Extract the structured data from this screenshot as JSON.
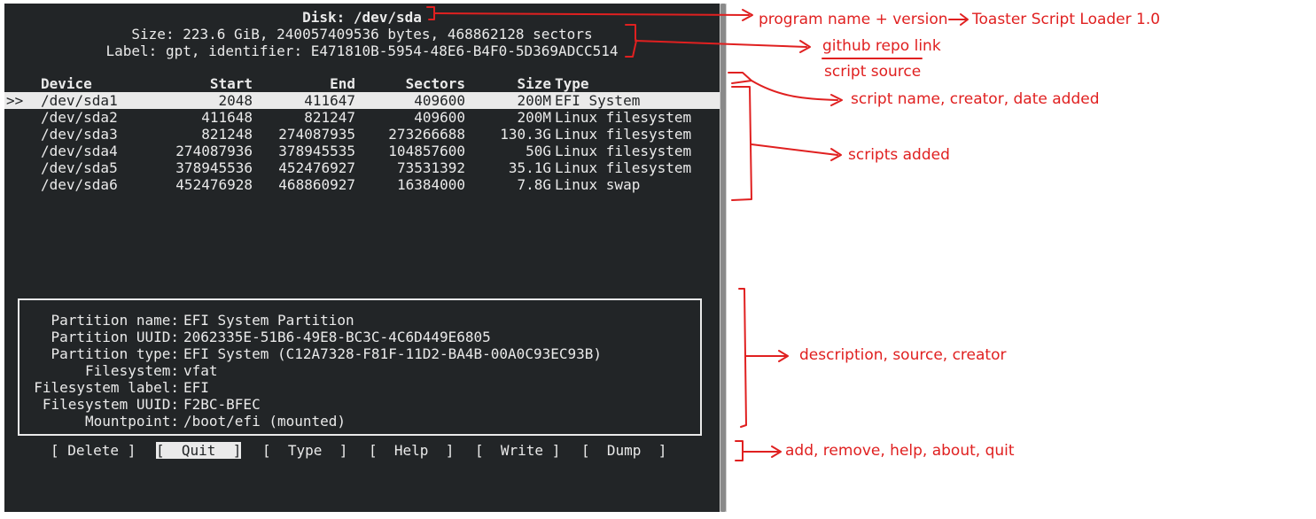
{
  "disk": {
    "title": "Disk: /dev/sda",
    "size_line": "Size: 223.6 GiB, 240057409536 bytes, 468862128 sectors",
    "label_line": "Label: gpt, identifier: E471810B-5954-48E6-B4F0-5D369ADCC514"
  },
  "table": {
    "headers": {
      "device": "Device",
      "start": "Start",
      "end": "End",
      "sectors": "Sectors",
      "size": "Size",
      "type": "Type"
    },
    "selected_marker": ">>",
    "rows": [
      {
        "device": "/dev/sda1",
        "start": "2048",
        "end": "411647",
        "sectors": "409600",
        "size": "200M",
        "type": "EFI System"
      },
      {
        "device": "/dev/sda2",
        "start": "411648",
        "end": "821247",
        "sectors": "409600",
        "size": "200M",
        "type": "Linux filesystem"
      },
      {
        "device": "/dev/sda3",
        "start": "821248",
        "end": "274087935",
        "sectors": "273266688",
        "size": "130.3G",
        "type": "Linux filesystem"
      },
      {
        "device": "/dev/sda4",
        "start": "274087936",
        "end": "378945535",
        "sectors": "104857600",
        "size": "50G",
        "type": "Linux filesystem"
      },
      {
        "device": "/dev/sda5",
        "start": "378945536",
        "end": "452476927",
        "sectors": "73531392",
        "size": "35.1G",
        "type": "Linux filesystem"
      },
      {
        "device": "/dev/sda6",
        "start": "452476928",
        "end": "468860927",
        "sectors": "16384000",
        "size": "7.8G",
        "type": "Linux swap"
      }
    ]
  },
  "info": [
    {
      "label": "Partition name:",
      "value": "EFI System Partition"
    },
    {
      "label": "Partition UUID:",
      "value": "2062335E-51B6-49E8-BC3C-4C6D449E6805"
    },
    {
      "label": "Partition type:",
      "value": "EFI System (C12A7328-F81F-11D2-BA4B-00A0C93EC93B)"
    },
    {
      "label": "Filesystem:",
      "value": "vfat"
    },
    {
      "label": "Filesystem label:",
      "value": "EFI"
    },
    {
      "label": "Filesystem UUID:",
      "value": "F2BC-BFEC"
    },
    {
      "label": "Mountpoint:",
      "value": "/boot/efi (mounted)"
    }
  ],
  "buttons": {
    "delete": "[ Delete ]",
    "quit": "[  Quit  ]",
    "type": "[  Type  ]",
    "help": "[  Help  ]",
    "write": "[  Write ]",
    "dump": "[  Dump  ]"
  },
  "annotations": {
    "program_name": "program name + version",
    "program_value": "Toaster Script Loader 1.0",
    "github": "github repo link",
    "script_source": "script source",
    "script_name": "script name, creator, date added",
    "scripts_added": "scripts added",
    "description": "description, source, creator",
    "actions": "add, remove, help, about, quit"
  },
  "colors": {
    "terminal_bg": "#222527",
    "terminal_fg": "#eaeaea",
    "annotation_red": "#e02020"
  }
}
